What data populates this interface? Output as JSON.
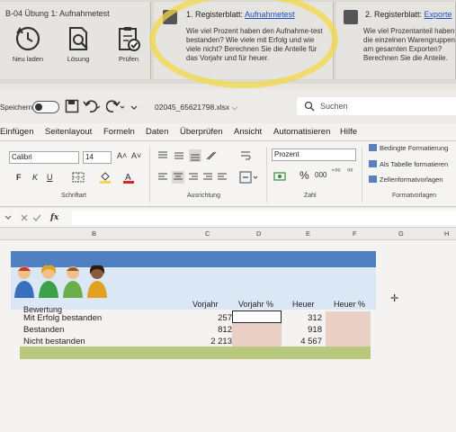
{
  "top_panels": {
    "left_title": "B-04 Übung 1: Aufnahmetest",
    "tools": [
      {
        "label": "Neu laden",
        "icon": "reload-clock-icon"
      },
      {
        "label": "Lösung",
        "icon": "solution-search-icon"
      },
      {
        "label": "Prüfen",
        "icon": "check-clipboard-icon"
      }
    ],
    "task1": {
      "prefix": "1. Registerblatt: ",
      "link": "Aufnahmetest",
      "text": "Wie viel Prozent haben den Aufnahme-test bestanden? Wie viele mit Erfolg und wie viele nicht? Berechnen Sie die Anteile für das Vorjahr und für heuer."
    },
    "task2": {
      "prefix": "2. Registerblatt: ",
      "link": "Exporte",
      "text": "Wie viel Prozentanteil haben die einzelnen Warengruppen am gesamten Exporten? Berechnen Sie die Anteile."
    },
    "highlight_color": "#f2d84a"
  },
  "titlebar": {
    "autosave_label": "Speichern",
    "filename": "02045_65621798.xlsx",
    "filename_chevron": "⌵",
    "search_placeholder": "Suchen"
  },
  "menu": [
    "Einfügen",
    "Seitenlayout",
    "Formeln",
    "Daten",
    "Überprüfen",
    "Ansicht",
    "Automatisieren",
    "Hilfe"
  ],
  "ribbon": {
    "font_name": "Calibri",
    "font_size": "14",
    "grow_font": "A˄",
    "shrink_font": "A˅",
    "bold": "F",
    "italic": "K",
    "underline": "U",
    "group_font": "Schriftart",
    "group_align": "Ausrichtung",
    "number_format": "Prozent",
    "percent": "%",
    "thousands": "000",
    "inc_dec": "⁺⁰⁰",
    "dec_dec": "⁰⁰",
    "group_number": "Zahl",
    "cond_format": "Bedingte Formatierung",
    "as_table": "Als Tabelle formatieren",
    "cell_styles": "Zellenformatvorlagen",
    "group_styles": "Formatvorlagen",
    "fx": "fx"
  },
  "columns": [
    "B",
    "C",
    "D",
    "E",
    "F",
    "G",
    "H"
  ],
  "table": {
    "headers": {
      "label": "Bewertung",
      "prev": "Vorjahr",
      "prev_pct": "Vorjahr %",
      "cur": "Heuer",
      "cur_pct": "Heuer %"
    },
    "rows": [
      {
        "label": "Mit Erfolg bestanden",
        "prev": "257",
        "cur": "312"
      },
      {
        "label": "Bestanden",
        "prev": "812",
        "cur": "918"
      },
      {
        "label": "Nicht bestanden",
        "prev": "2 213",
        "cur": "4 567"
      }
    ]
  },
  "colors": {
    "banner_blue": "#4f80c2",
    "banner_light": "#dbe7f4",
    "pct_cells": "#e9cfc6",
    "total_row": "#b8c97d"
  }
}
